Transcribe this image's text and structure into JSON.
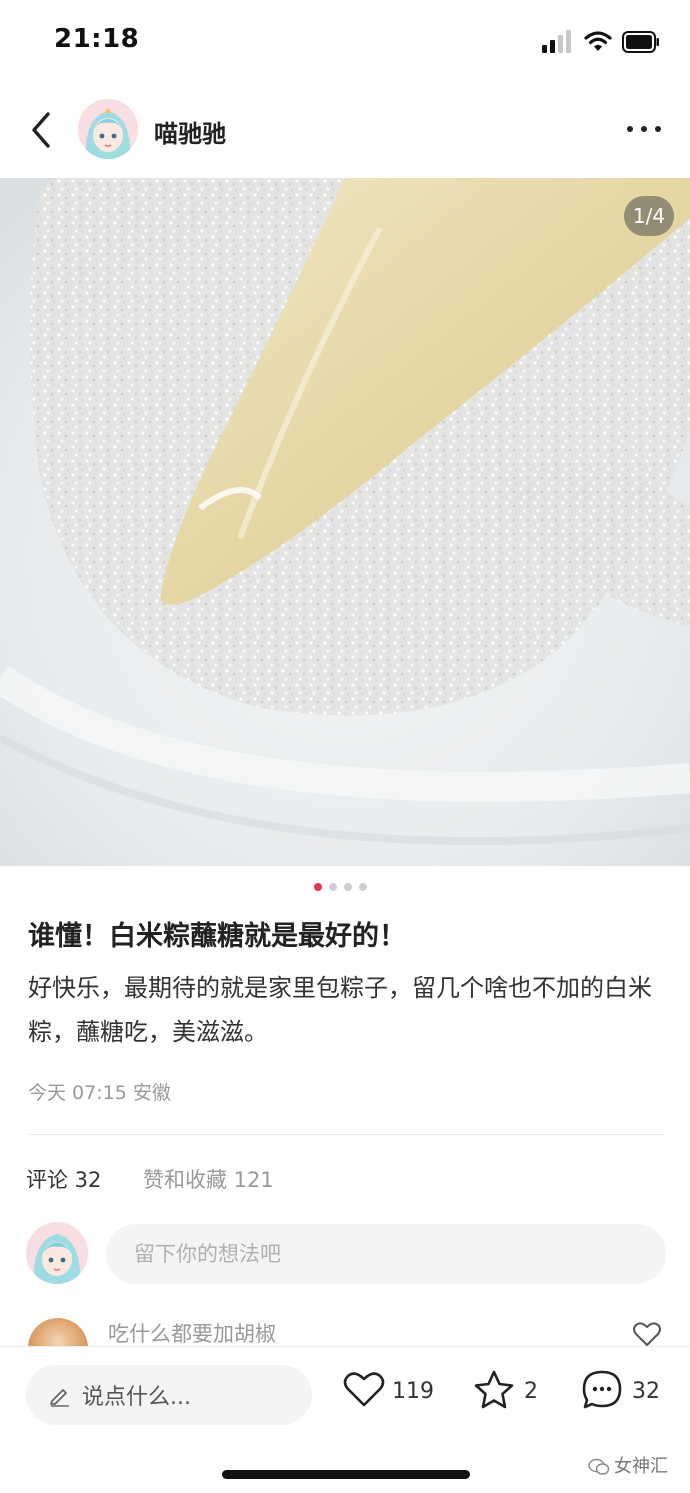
{
  "status_bar": {
    "time": "21:18"
  },
  "header": {
    "author": "喵驰驰"
  },
  "photo": {
    "counter": "1/4",
    "page_count": 4,
    "current_page": 1
  },
  "post": {
    "title": "谁懂！白米粽蘸糖就是最好的！",
    "body": "好快乐，最期待的就是家里包粽子，留几个啥也不加的白米粽，蘸糖吃，美滋滋。",
    "meta": "今天 07:15 安徽"
  },
  "comments_section": {
    "comments_tab": "评论 32",
    "likes_tab": "赞和收藏 121",
    "input_placeholder": "留下你的想法吧",
    "first_comment": "吃什么都要加胡椒"
  },
  "bottom_bar": {
    "say_placeholder": "说点什么...",
    "like_count": "119",
    "collect_count": "2",
    "comment_count": "32"
  },
  "watermark": "女神汇",
  "colors": {
    "accent": "#e8334a",
    "muted": "#999999"
  }
}
